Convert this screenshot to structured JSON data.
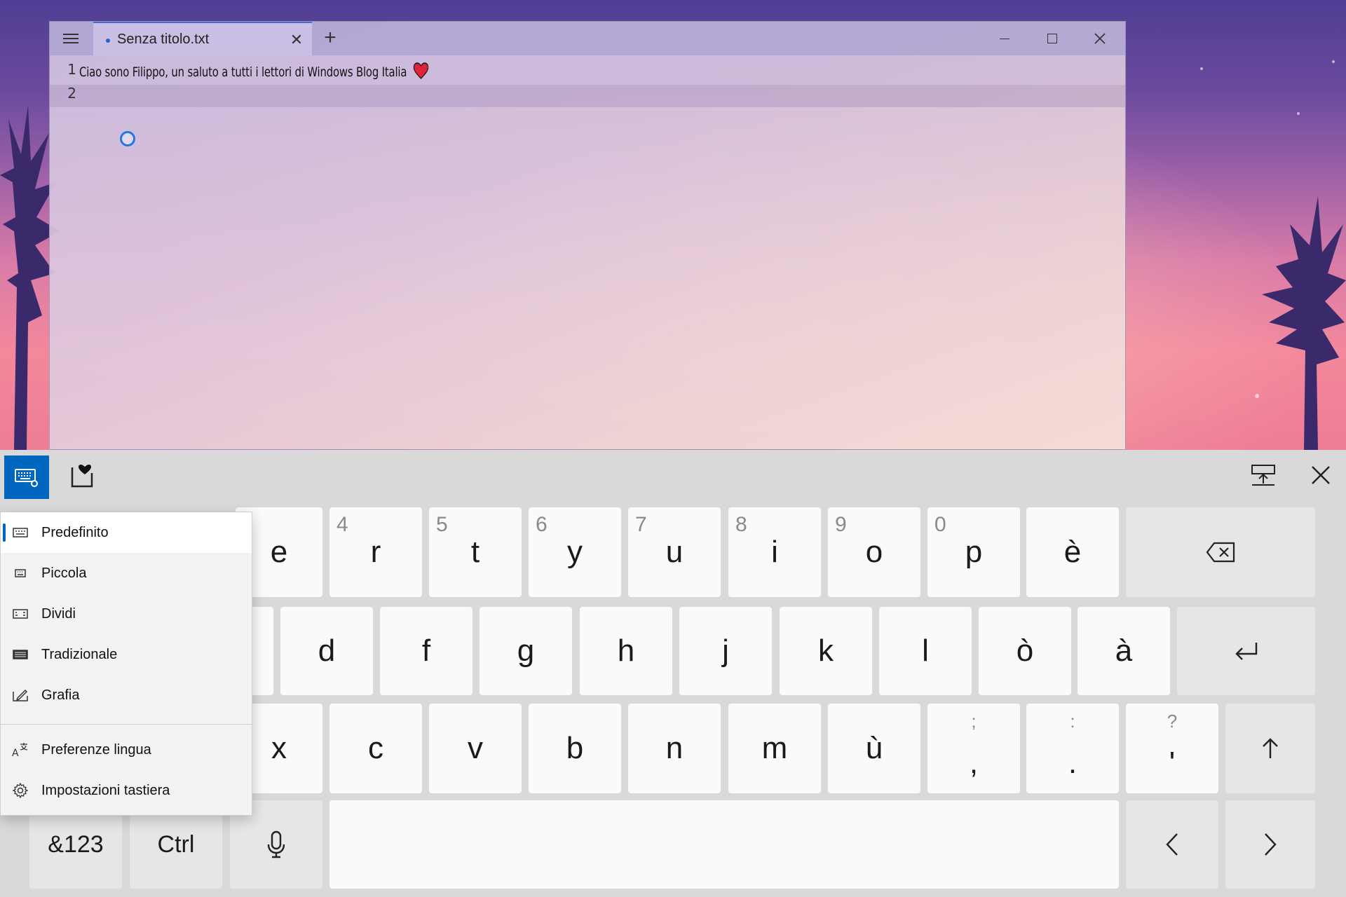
{
  "window": {
    "tab_title": "Senza titolo.txt",
    "new_tab_symbol": "+",
    "close_tab_symbol": "✕"
  },
  "editor": {
    "lines": [
      {
        "number": "1",
        "text": "Ciao sono Filippo, un saluto a tutti i lettori di Windows Blog Italia"
      },
      {
        "number": "2",
        "text": ""
      }
    ]
  },
  "keyboard": {
    "row1": [
      {
        "main": "e",
        "sec": ""
      },
      {
        "main": "r",
        "sec": "4"
      },
      {
        "main": "t",
        "sec": "5"
      },
      {
        "main": "y",
        "sec": "6"
      },
      {
        "main": "u",
        "sec": "7"
      },
      {
        "main": "i",
        "sec": "8"
      },
      {
        "main": "o",
        "sec": "9"
      },
      {
        "main": "p",
        "sec": "0"
      },
      {
        "main": "è",
        "sec": ""
      }
    ],
    "row2": [
      "d",
      "f",
      "g",
      "h",
      "j",
      "k",
      "l",
      "ò",
      "à"
    ],
    "row3": [
      "x",
      "c",
      "v",
      "b",
      "n",
      "m",
      "ù"
    ],
    "row3_punct": [
      {
        "main": ",",
        "sec": ";"
      },
      {
        "main": ".",
        "sec": ":"
      },
      {
        "main": "'",
        "sec": "?"
      }
    ],
    "row4": {
      "symbols_label": "&123",
      "ctrl_label": "Ctrl"
    }
  },
  "layout_menu": {
    "items": [
      {
        "label": "Predefinito",
        "icon": "keyboard-default-icon",
        "selected": true
      },
      {
        "label": "Piccola",
        "icon": "keyboard-small-icon",
        "selected": false
      },
      {
        "label": "Dividi",
        "icon": "keyboard-split-icon",
        "selected": false
      },
      {
        "label": "Tradizionale",
        "icon": "keyboard-traditional-icon",
        "selected": false
      },
      {
        "label": "Grafia",
        "icon": "handwriting-icon",
        "selected": false
      }
    ],
    "footer_items": [
      {
        "label": "Preferenze lingua",
        "icon": "language-icon"
      },
      {
        "label": "Impostazioni tastiera",
        "icon": "gear-icon"
      }
    ]
  },
  "colors": {
    "accent": "#0067c0",
    "key_bg": "#fafafa",
    "keyboard_bg": "#d9d9d9",
    "heart": "#e0223a"
  }
}
